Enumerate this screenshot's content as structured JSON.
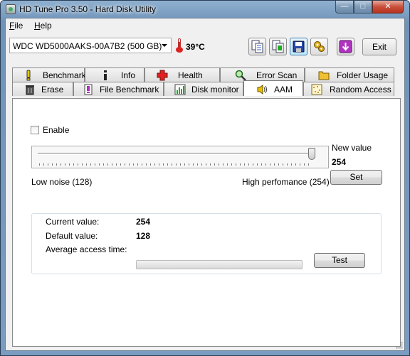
{
  "window": {
    "title": "HD Tune Pro 3.50 - Hard Disk Utility"
  },
  "titlebar_buttons": {
    "minimize": "—",
    "maximize": "□",
    "close": "✕"
  },
  "menu": {
    "file": {
      "mnemonic": "F",
      "rest": "ile"
    },
    "help": {
      "mnemonic": "H",
      "rest": "elp"
    }
  },
  "toolbar": {
    "drive": "WDC WD5000AAKS-00A7B2 (500 GB)",
    "temperature": "39°C",
    "exit_label": "Exit",
    "buttons": [
      "copy-text-icon",
      "copy-screenshot-icon",
      "save-icon",
      "options-icon",
      "down-arrow-icon"
    ]
  },
  "tabs": {
    "row1": [
      {
        "label": "Benchmark",
        "icon": "exclamation-icon"
      },
      {
        "label": "Info",
        "icon": "info-icon"
      },
      {
        "label": "Health",
        "icon": "health-cross-icon"
      },
      {
        "label": "Error Scan",
        "icon": "magnifier-icon"
      },
      {
        "label": "Folder Usage",
        "icon": "folder-icon"
      }
    ],
    "row2": [
      {
        "label": "Erase",
        "icon": "trash-icon"
      },
      {
        "label": "File Benchmark",
        "icon": "file-benchmark-icon"
      },
      {
        "label": "Disk monitor",
        "icon": "chart-icon"
      },
      {
        "label": "AAM",
        "icon": "speaker-icon",
        "selected": true
      },
      {
        "label": "Random Access",
        "icon": "random-access-icon"
      }
    ]
  },
  "aam": {
    "enable_label": "Enable",
    "enabled": false,
    "new_value_label": "New value",
    "new_value": "254",
    "slider": {
      "min": 128,
      "max": 254,
      "value": 254
    },
    "low_label": "Low noise (128)",
    "high_label": "High perfomance (254)",
    "set_label": "Set",
    "current_label": "Current value:",
    "current_value": "254",
    "default_label": "Default value:",
    "default_value": "128",
    "avg_access_label": "Average access time:",
    "avg_access_progress": 0,
    "test_label": "Test"
  }
}
